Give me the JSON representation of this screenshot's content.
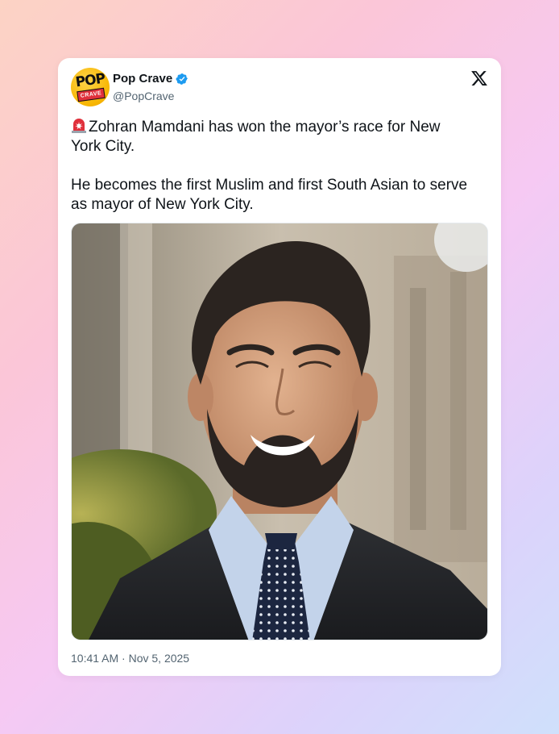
{
  "tweet": {
    "display_name": "Pop Crave",
    "handle": "@PopCrave",
    "verified": true,
    "avatar": {
      "word1": "POP",
      "word2": "CRAVE"
    },
    "emoji": "police-light-icon",
    "paragraph1": "Zohran Mamdani has won the mayor’s race for New York City.",
    "paragraph2": "He becomes the first Muslim and first South Asian to serve as mayor of New York City.",
    "timestamp": "10:41 AM · Nov 5, 2025"
  },
  "colors": {
    "verified_blue": "#1d9bf0",
    "text_primary": "#0f1419",
    "text_secondary": "#536471"
  },
  "icons": {
    "brand": "x-logo-icon",
    "badge": "verified-badge-icon"
  }
}
